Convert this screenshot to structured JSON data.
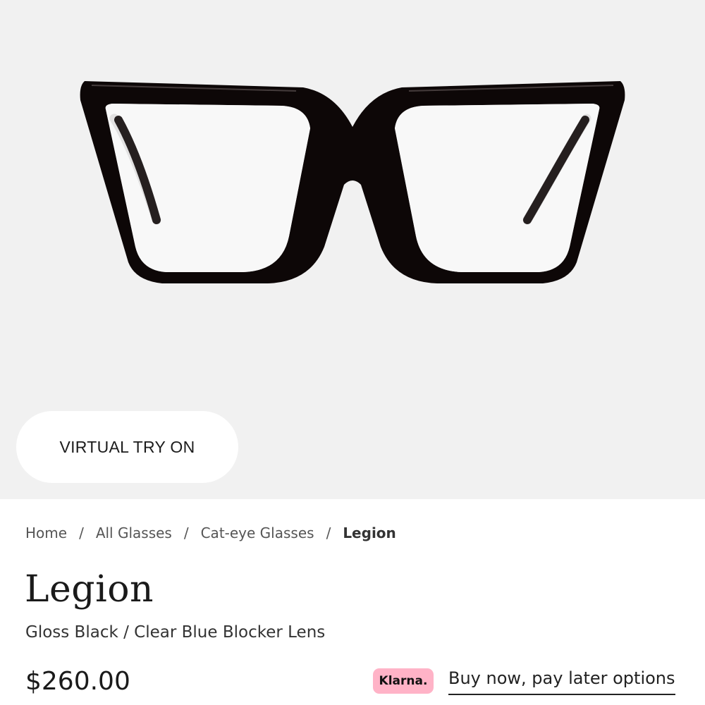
{
  "hero": {
    "product_image": "cat-eye-glasses-front",
    "try_on_label": "VIRTUAL TRY ON",
    "background_color": "#f1f1f1"
  },
  "breadcrumb": {
    "items": [
      "Home",
      "All Glasses",
      "Cat-eye Glasses"
    ],
    "current": "Legion",
    "separator": "/"
  },
  "product": {
    "name": "Legion",
    "variant": "Gloss Black / Clear Blue Blocker Lens",
    "price": "$260.00"
  },
  "financing": {
    "provider_badge": "Klarna.",
    "badge_color": "#ffb3c7",
    "link_label": "Buy now, pay later options"
  }
}
